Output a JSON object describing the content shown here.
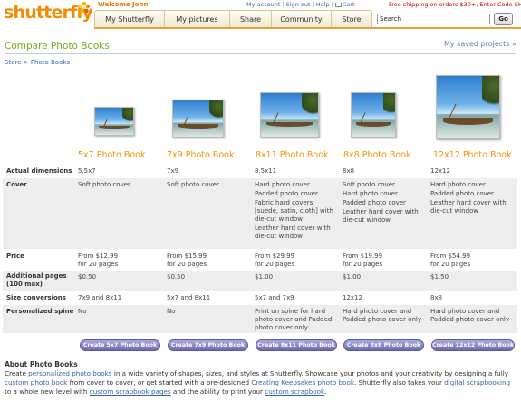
{
  "header": {
    "logo": "shutterfly",
    "welcome": "Welcome John",
    "links": [
      "My account",
      "Sign out",
      "Help",
      "Cart"
    ],
    "promo": "Free shipping on orders $30+, Enter Code SHIP30",
    "nav": [
      "My Shutterfly",
      "My pictures",
      "Share",
      "Community",
      "Store"
    ],
    "search_value": "Search",
    "go_label": "Go"
  },
  "page": {
    "title": "Compare Photo Books",
    "saved_projects": "My saved projects »",
    "breadcrumb": "Store > Photo Books"
  },
  "products": [
    {
      "name": "5x7 Photo Book",
      "dimensions": "5.5x7",
      "cover": [
        "Soft photo cover"
      ],
      "price": [
        "From $12.99",
        "for 20 pages"
      ],
      "additional": "$0.50",
      "size_conversions": "7x9 and 8x11",
      "spine": [
        "No"
      ],
      "button": "Create 5x7 Photo Book"
    },
    {
      "name": "7x9 Photo Book",
      "dimensions": "7x9",
      "cover": [
        "Soft photo cover"
      ],
      "price": [
        "From $15.99",
        "for 20 pages"
      ],
      "additional": "$0.50",
      "size_conversions": "5x7 and 8x11",
      "spine": [
        "No"
      ],
      "button": "Create 7x9 Photo Book"
    },
    {
      "name": "8x11 Photo Book",
      "dimensions": "8.5x11",
      "cover": [
        "Hard photo cover",
        "Padded photo cover",
        "Fabric hard covers [suede, satin, cloth] with die-cut window",
        "Leather hard cover with die-cut window"
      ],
      "price": [
        "From $29.99",
        "for 20 pages"
      ],
      "additional": "$1.00",
      "size_conversions": "5x7 and 7x9",
      "spine": [
        "Print on spine for hard photo cover and Padded photo cover only"
      ],
      "button": "Create 8x11 Photo Book"
    },
    {
      "name": "8x8 Photo Book",
      "dimensions": "8x8",
      "cover": [
        "Soft photo cover",
        "Hard photo cover",
        "Padded photo cover",
        "Leather hard cover with die-cut window"
      ],
      "price": [
        "From $19.99",
        "for 20 pages"
      ],
      "additional": "$1.00",
      "size_conversions": "12x12",
      "spine": [
        "Hard photo cover and Padded photo cover only"
      ],
      "button": "Create 8x8 Photo Book"
    },
    {
      "name": "12x12 Photo Book",
      "dimensions": "12x12",
      "cover": [
        "Hard photo cover",
        "Padded photo cover",
        "Leather hard cover with die-cut window"
      ],
      "price": [
        "From $54.99",
        "for 20 pages"
      ],
      "additional": "$1.50",
      "size_conversions": "8x8",
      "spine": [
        "Hard photo cover and Padded photo cover only"
      ],
      "button": "Create 12x12 Photo Book"
    }
  ],
  "row_labels": {
    "dimensions": "Actual dimensions",
    "cover": "Cover",
    "price": "Price",
    "additional": [
      "Additional pages",
      "(100 max)"
    ],
    "size_conversions": "Size conversions",
    "spine": "Personalized spine"
  },
  "about": {
    "title": "About Photo Books",
    "t1": "Create ",
    "l1": "personalized photo books",
    "t2": " in a wide variety of shapes, sizes, and styles at Shutterfly. Showcase your photos and your creativity by designing a fully ",
    "l2": "custom photo book",
    "t3": " from cover to cover, or get started with a pre-designed ",
    "l3": "Creating Keepsakes photo book",
    "t4": ". Shutterfly also takes your ",
    "l4": "digital scrapbooking",
    "t5": " to a whole new level with ",
    "l5": "custom scrapbook pages",
    "t6": " and the ability to print your ",
    "l6": "custom scrapbook",
    "t7": "."
  },
  "colors": {
    "accent": "#f29400",
    "title_green": "#7aab1d",
    "link": "#3366aa",
    "button": "#7373b8"
  }
}
